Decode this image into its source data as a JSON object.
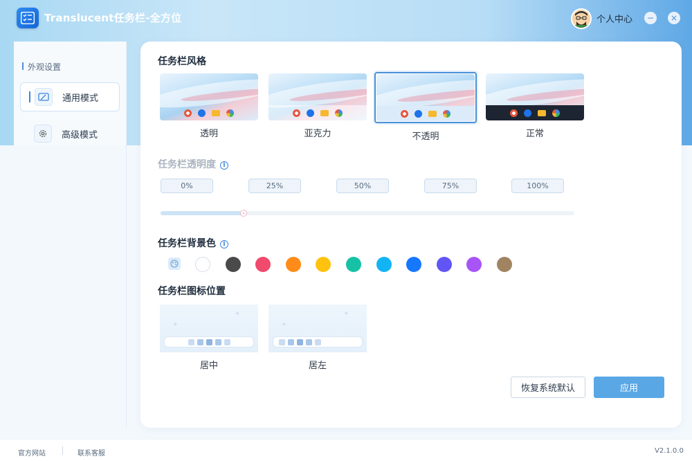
{
  "app": {
    "title": "Translucent任务栏-全方位"
  },
  "header": {
    "user_center": "个人中心",
    "minimize": "−",
    "close": "×"
  },
  "sidebar": {
    "section": "外观设置",
    "items": [
      {
        "label": "通用模式",
        "icon": "edit-window-icon",
        "active": true
      },
      {
        "label": "高级模式",
        "icon": "gear-icon",
        "active": false
      }
    ]
  },
  "style": {
    "title": "任务栏风格",
    "options": [
      {
        "label": "透明",
        "selected": false
      },
      {
        "label": "亚克力",
        "selected": false
      },
      {
        "label": "不透明",
        "selected": true
      },
      {
        "label": "正常",
        "selected": false
      }
    ]
  },
  "opacity": {
    "title": "任务栏透明度",
    "presets": [
      "0%",
      "25%",
      "50%",
      "75%",
      "100%"
    ],
    "value_fraction": 0.2
  },
  "background_color": {
    "title": "任务栏背景色",
    "colors": [
      "#ffffff",
      "#4a4a4a",
      "#f04a6c",
      "#ff8c1a",
      "#ffc20e",
      "#17c1a6",
      "#12b4f5",
      "#1677ff",
      "#6155f5",
      "#a855f7",
      "#a08462"
    ]
  },
  "icon_position": {
    "title": "任务栏图标位置",
    "options": [
      {
        "label": "居中"
      },
      {
        "label": "居左"
      }
    ]
  },
  "actions": {
    "restore": "恢复系统默认",
    "apply": "应用"
  },
  "footer": {
    "website": "官方网站",
    "support": "联系客服",
    "version": "V2.1.0.0"
  }
}
